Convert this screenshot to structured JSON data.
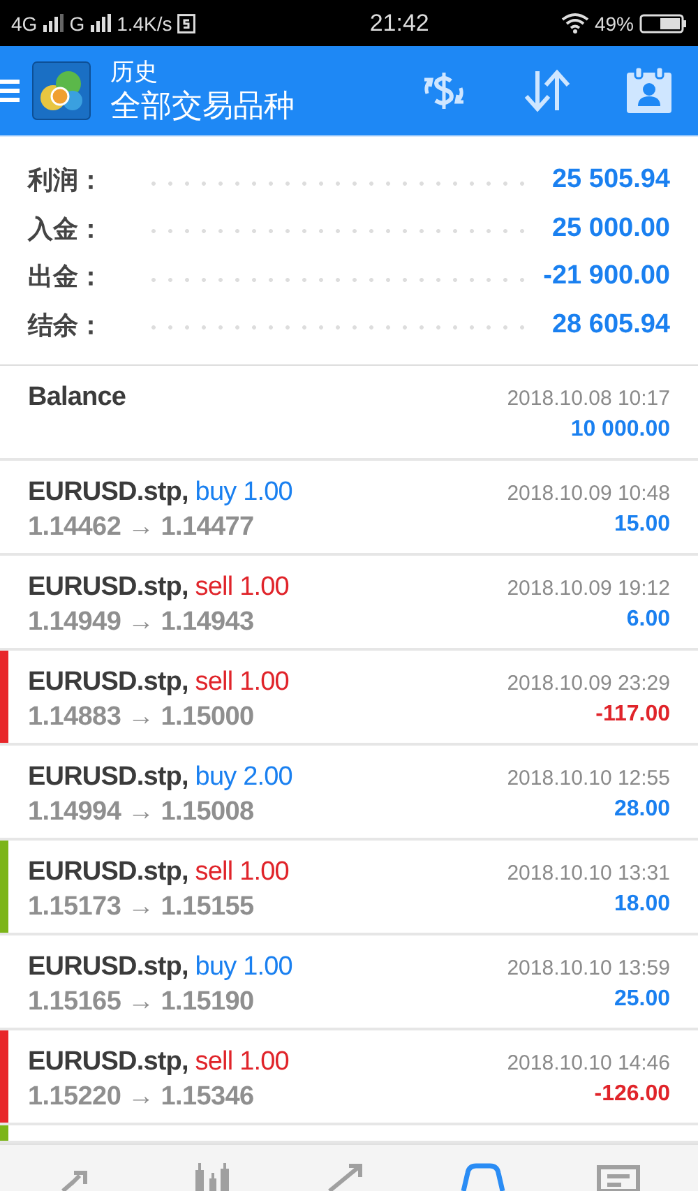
{
  "status_bar": {
    "network_1": "4G",
    "network_2": "G",
    "speed": "1.4K/s",
    "time": "21:42",
    "battery": "49%"
  },
  "app_bar": {
    "title": "历史",
    "subtitle": "全部交易品种"
  },
  "summary": [
    {
      "label": "利润：",
      "value": "25 505.94"
    },
    {
      "label": "入金：",
      "value": "25 000.00"
    },
    {
      "label": "出金：",
      "value": "-21 900.00"
    },
    {
      "label": "结余：",
      "value": "28 605.94"
    }
  ],
  "rows": [
    {
      "kind": "balance",
      "title": "Balance",
      "time": "2018.10.08 10:17",
      "amount": "10 000.00",
      "negative": false
    },
    {
      "kind": "trade",
      "symbol": "EURUSD.stp,",
      "side": "buy",
      "volume": "1.00",
      "prices": "1.14462 → 1.14477",
      "time": "2018.10.09 10:48",
      "amount": "15.00",
      "negative": false
    },
    {
      "kind": "trade",
      "symbol": "EURUSD.stp,",
      "side": "sell",
      "volume": "1.00",
      "prices": "1.14949 → 1.14943",
      "time": "2018.10.09 19:12",
      "amount": "6.00",
      "negative": false
    },
    {
      "kind": "trade",
      "symbol": "EURUSD.stp,",
      "side": "sell",
      "volume": "1.00",
      "prices": "1.14883 → 1.15000",
      "time": "2018.10.09 23:29",
      "amount": "-117.00",
      "negative": true,
      "color": "#e8262a"
    },
    {
      "kind": "trade",
      "symbol": "EURUSD.stp,",
      "side": "buy",
      "volume": "2.00",
      "prices": "1.14994 → 1.15008",
      "time": "2018.10.10 12:55",
      "amount": "28.00",
      "negative": false
    },
    {
      "kind": "trade",
      "symbol": "EURUSD.stp,",
      "side": "sell",
      "volume": "1.00",
      "prices": "1.15173 → 1.15155",
      "time": "2018.10.10 13:31",
      "amount": "18.00",
      "negative": false,
      "color": "#7cb518"
    },
    {
      "kind": "trade",
      "symbol": "EURUSD.stp,",
      "side": "buy",
      "volume": "1.00",
      "prices": "1.15165 → 1.15190",
      "time": "2018.10.10 13:59",
      "amount": "25.00",
      "negative": false
    },
    {
      "kind": "trade",
      "symbol": "EURUSD.stp,",
      "side": "sell",
      "volume": "1.00",
      "prices": "1.15220 → 1.15346",
      "time": "2018.10.10 14:46",
      "amount": "-126.00",
      "negative": true,
      "color": "#e8262a"
    },
    {
      "kind": "partial",
      "color": "#7cb518"
    }
  ],
  "nav": [
    {
      "kind": "quotes",
      "selected": false
    },
    {
      "kind": "chart",
      "selected": false
    },
    {
      "kind": "trade",
      "selected": false
    },
    {
      "kind": "history",
      "selected": true
    },
    {
      "kind": "news",
      "selected": false
    }
  ]
}
